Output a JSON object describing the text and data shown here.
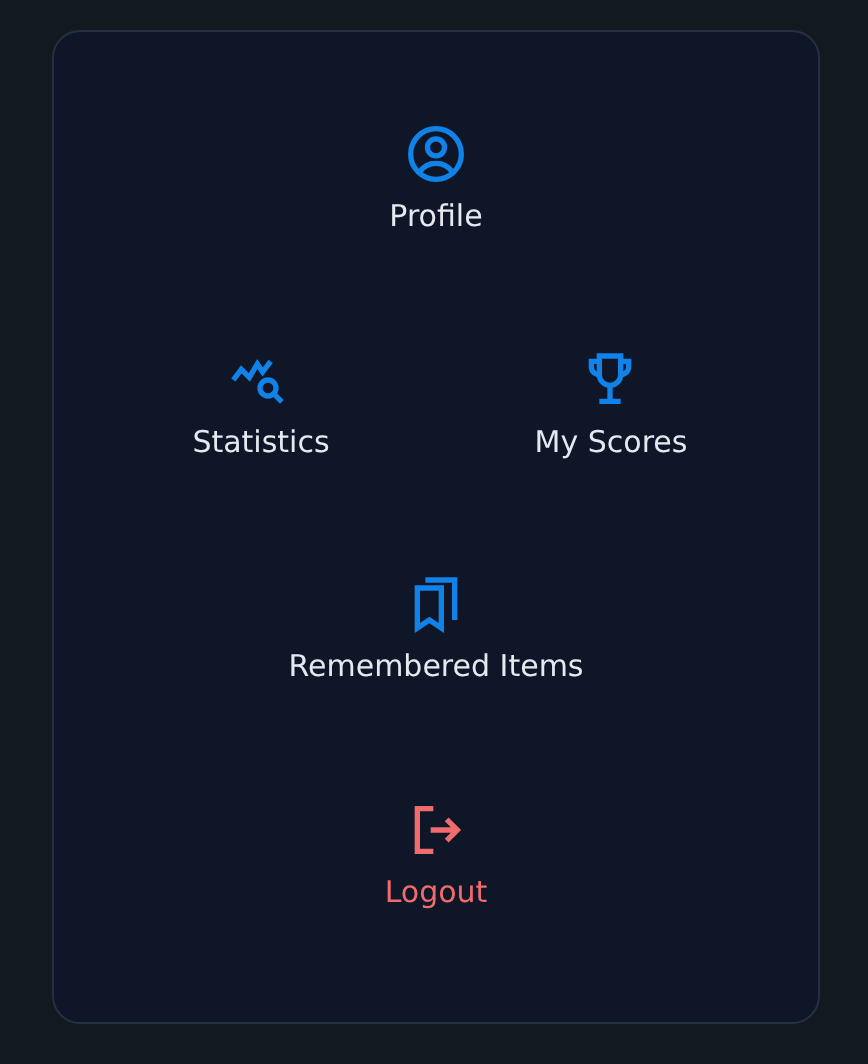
{
  "menu": {
    "rows": [
      [
        {
          "label": "Profile",
          "kind": "link"
        }
      ],
      [
        {
          "label": "Statistics",
          "kind": "link"
        },
        {
          "label": "My Scores",
          "kind": "link"
        }
      ],
      [
        {
          "label": "Remembered Items",
          "kind": "link"
        }
      ],
      [
        {
          "label": "Logout",
          "kind": "danger"
        }
      ]
    ]
  }
}
